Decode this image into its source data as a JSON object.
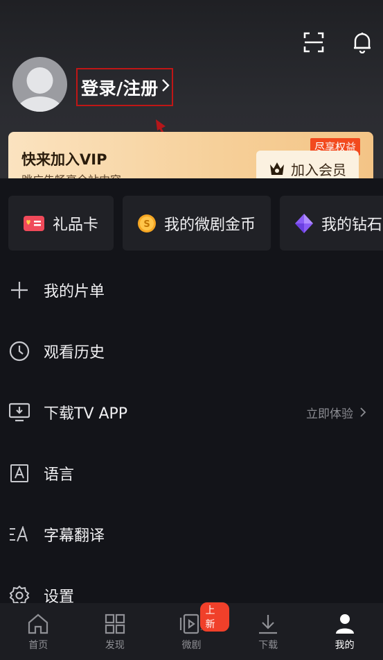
{
  "header": {
    "login_label": "登录/注册",
    "icons": [
      "scan-icon",
      "bell-icon"
    ]
  },
  "vip": {
    "title": "快来加入VIP",
    "subtitle": "跳广告畅享全站内容",
    "button_label": "加入会员",
    "tag": "尽享权益"
  },
  "chips": [
    {
      "label": "礼品卡",
      "icon": "gift-card-icon"
    },
    {
      "label": "我的微剧金币",
      "icon": "coin-icon"
    },
    {
      "label": "我的钻石",
      "icon": "diamond-icon"
    }
  ],
  "menu": [
    {
      "label": "我的片单",
      "icon": "plus-icon"
    },
    {
      "label": "观看历史",
      "icon": "clock-icon"
    },
    {
      "label": "下载TV APP",
      "icon": "tv-download-icon",
      "right": "立即体验"
    },
    {
      "label": "语言",
      "icon": "language-icon"
    },
    {
      "label": "字幕翻译",
      "icon": "subtitle-translate-icon"
    },
    {
      "label": "设置",
      "icon": "gear-icon"
    }
  ],
  "tabs": [
    {
      "label": "首页",
      "icon": "home-icon"
    },
    {
      "label": "发现",
      "icon": "grid-icon"
    },
    {
      "label": "微剧",
      "icon": "short-drama-icon",
      "badge": "上新"
    },
    {
      "label": "下载",
      "icon": "download-icon"
    },
    {
      "label": "我的",
      "icon": "profile-icon",
      "active": true
    }
  ],
  "colors": {
    "accent_red": "#c01616",
    "vip_gold": "#f6cf98",
    "badge_red": "#f0402a"
  }
}
